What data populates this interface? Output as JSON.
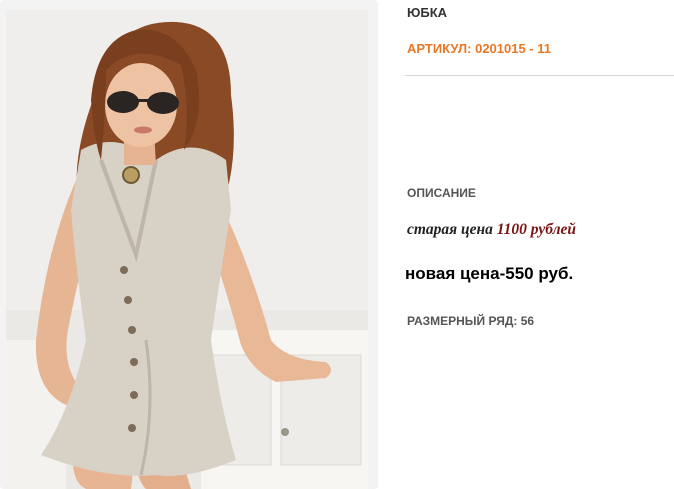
{
  "product": {
    "title": "ЮБКА",
    "sku": "АРТИКУЛ: 0201015 - 11",
    "description_heading": "ОПИСАНИЕ",
    "old_price_label": "старая цена",
    "old_price_value": "1100 рублей",
    "new_price": "новая цена-550 руб.",
    "size_row": "РАЗМЕРНЫЙ РЯД: 56"
  },
  "colors": {
    "sku": "#e87824",
    "old_price_value": "#7b1414"
  }
}
